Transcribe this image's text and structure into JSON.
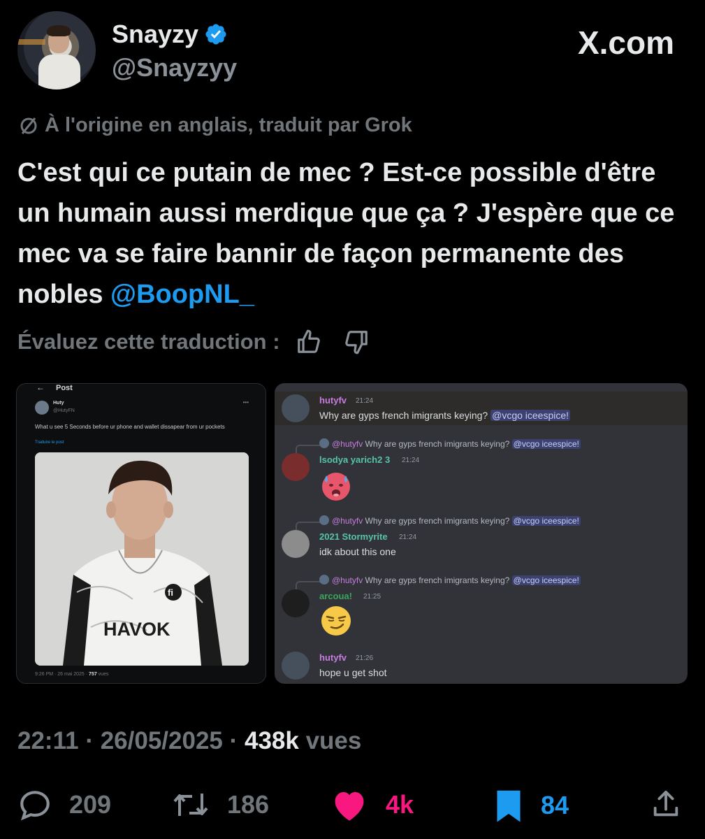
{
  "author": {
    "name": "Snayzy",
    "handle": "@Snayzyy",
    "verified": true
  },
  "site": "X.com",
  "translation_note": "À l'origine en anglais, traduit par Grok",
  "tweet": {
    "text_before": "C'est qui ce putain de mec ? Est-ce possible d'être un humain aussi merdique que ça ? J'espère que ce mec va se faire bannir de façon permanente des nobles ",
    "mention": "@BoopNL_"
  },
  "rate_label": "Évaluez cette traduction :",
  "embedded_post": {
    "back": "←",
    "header": "Post",
    "name": "Huty",
    "handle": "@HutyFN",
    "dots": "•••",
    "text": "What u see 5 Seconds before ur phone and wallet dissapear from ur pockets",
    "translate": "Traduire le post",
    "jersey": "HAVOK",
    "footer_time": "9:26 PM · 26 mai 2025 · ",
    "footer_views": "757",
    "footer_views_label": " vues"
  },
  "discord": {
    "messages": [
      {
        "name": "hutyfv",
        "name_color": "#c77dde",
        "time": "21:24",
        "text": "Why are gyps french imigrants keying? ",
        "mention": "@vcgo iceespice!"
      },
      {
        "reply_name": "@hutyfv",
        "reply_text": "Why are gyps french imigrants keying? ",
        "reply_mention": "@vcgo iceespice!",
        "name": "lsodya yarich2 3",
        "name_color": "#57c4a8",
        "time": "21:24",
        "emoji": "hot-face"
      },
      {
        "reply_name": "@hutyfv",
        "reply_text": "Why are gyps french imigrants keying? ",
        "reply_mention": "@vcgo iceespice!",
        "name": "2021 Stormyrite",
        "name_color": "#57c4a8",
        "time": "21:24",
        "text": "idk about this one"
      },
      {
        "reply_name": "@hutyfv",
        "reply_text": "Why are gyps french imigrants keying? ",
        "reply_mention": "@vcgo iceespice!",
        "name": "arcoua!",
        "name_color": "#3ba55c",
        "time": "21:25",
        "emoji": "smirk"
      },
      {
        "name": "hutyfv",
        "name_color": "#c77dde",
        "time": "21:26",
        "text": "hope u get shot"
      }
    ]
  },
  "meta": {
    "time": "22:11",
    "sep1": " · ",
    "date": "26/05/2025",
    "sep2": " · ",
    "views": "438k",
    "views_label": " vues"
  },
  "actions": {
    "replies": "209",
    "reposts": "186",
    "likes": "4k",
    "bookmarks": "84"
  },
  "colors": {
    "like": "#f91880",
    "bookmark": "#1d9bf0",
    "mention": "#1d9bf0",
    "muted": "#71767b"
  }
}
